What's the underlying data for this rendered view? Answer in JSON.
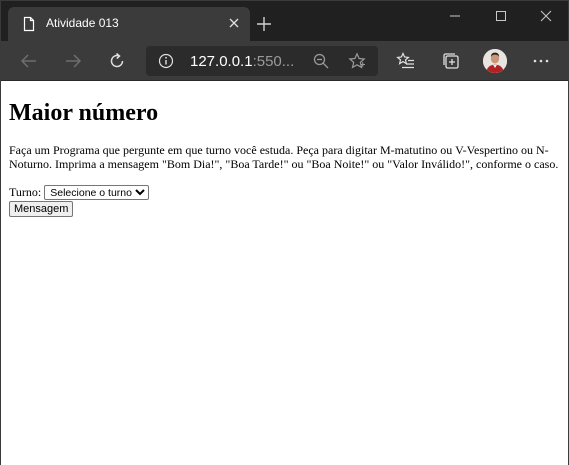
{
  "tab": {
    "title": "Atividade 013"
  },
  "omnibox": {
    "url_host": "127.0.0.1",
    "url_rest": ":550..."
  },
  "page": {
    "heading": "Maior número",
    "description": "Faça um Programa que pergunte em que turno você estuda. Peça para digitar M-matutino ou V-Vespertino ou N-Noturno. Imprima a mensagem \"Bom Dia!\", \"Boa Tarde!\" ou \"Boa Noite!\" ou \"Valor Inválido!\", conforme o caso.",
    "turno_label": "Turno:",
    "turno_select_value": "Selecione o turno",
    "button_label": "Mensagem"
  },
  "icons": {
    "tab": "document-icon",
    "close": "close-icon",
    "new_tab": "plus-icon",
    "back": "back-arrow-icon",
    "forward": "forward-arrow-icon",
    "refresh": "refresh-icon",
    "info": "info-icon",
    "zoom": "zoom-out-icon",
    "favorite": "star-icon",
    "favorites": "favorites-list-icon",
    "collections": "collections-icon",
    "profile": "avatar",
    "menu": "more-icon"
  }
}
